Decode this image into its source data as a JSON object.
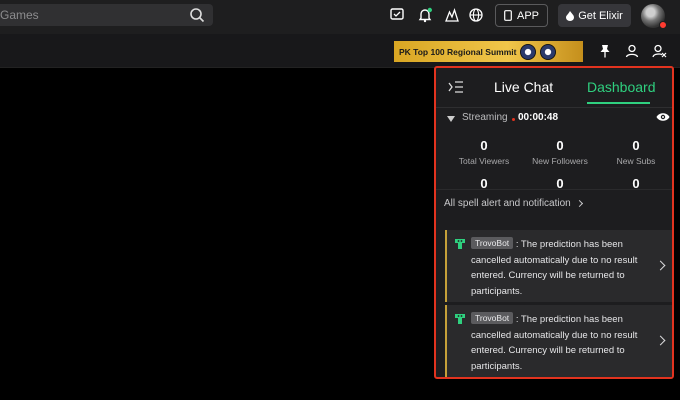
{
  "topbar": {
    "search_placeholder": "Games",
    "app_label": "APP",
    "elixir_label": "Get Elixir",
    "icons": [
      "chat-icon",
      "bell-icon",
      "mountain-icon",
      "globe-icon"
    ]
  },
  "banner": {
    "text": "PK Top 100 Regional Summit"
  },
  "panel": {
    "tabs": [
      {
        "label": "Live Chat"
      },
      {
        "label": "Dashboard"
      }
    ],
    "stream": {
      "label": "Streaming",
      "time": "00:00:48"
    },
    "stats": [
      {
        "value": "0",
        "label": "Total Viewers"
      },
      {
        "value": "0",
        "label": "New Followers"
      },
      {
        "value": "0",
        "label": "New Subs"
      },
      {
        "value": "0",
        "label": ""
      },
      {
        "value": "0",
        "label": ""
      },
      {
        "value": "0",
        "label": ""
      }
    ],
    "spell_link": "All spell alert and notification",
    "notifications": [
      {
        "sender": "TrovoBot",
        "message": ": The prediction has been cancelled automatically due to no result entered. Currency will be returned to participants."
      },
      {
        "sender": "TrovoBot",
        "message": ": The prediction has been cancelled automatically due to no result entered. Currency will be returned to participants."
      }
    ]
  },
  "colors": {
    "accent_green": "#2fd07f",
    "highlight_border": "#e2331f",
    "notif_bar": "#c5a039"
  }
}
